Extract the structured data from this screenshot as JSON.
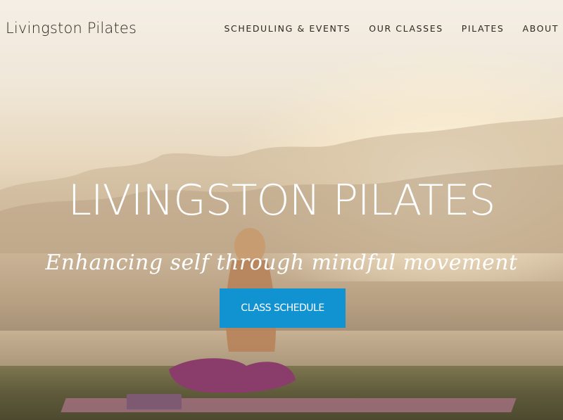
{
  "brand": {
    "logo_text": "Livingston Pilates"
  },
  "nav": {
    "items": [
      {
        "label": "SCHEDULING & EVENTS"
      },
      {
        "label": "OUR CLASSES"
      },
      {
        "label": "PILATES"
      },
      {
        "label": "ABOUT"
      }
    ]
  },
  "hero": {
    "title": "LIVINGSTON PILATES",
    "tagline": "Enhancing self through mindful movement",
    "cta_label": "CLASS SCHEDULE",
    "cta_color": "#1193d2"
  }
}
